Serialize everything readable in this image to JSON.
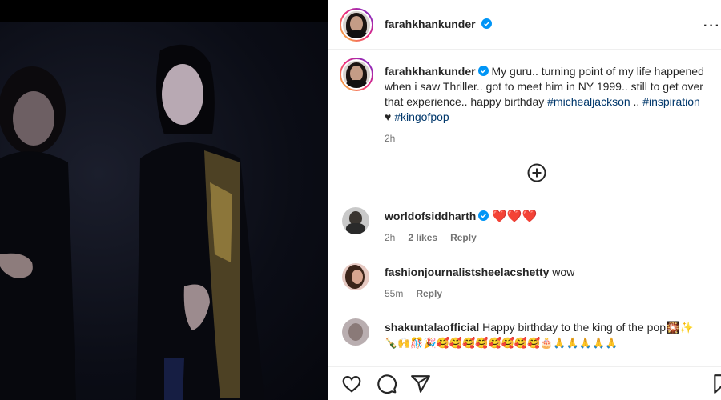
{
  "post": {
    "author": "farahkhankunder",
    "caption_text": "My guru.. turning point of my life happened when i saw Thriller.. got to meet him in NY 1999.. still to get over that experience.. happy birthday ",
    "tag1": "#michealjackson",
    "mid": " .. ",
    "tag2": "#inspiration",
    "heart": "♥ ",
    "tag3": "#kingofpop",
    "time": "2h",
    "more": "···"
  },
  "comments": [
    {
      "user": "worldofsiddharth",
      "verified": true,
      "text": "❤️❤️❤️",
      "time": "2h",
      "likes": "2 likes",
      "reply": "Reply"
    },
    {
      "user": "fashionjournalistsheelacshetty",
      "verified": false,
      "text": "wow",
      "time": "55m",
      "likes": "",
      "reply": "Reply"
    },
    {
      "user": "shakuntalaofficial",
      "verified": false,
      "text": "Happy birthday to the king of the pop🎇✨",
      "text2": "🍾🙌🎊🎉🥰🥰🥰🥰🥰🥰🥰🥰🎂🙏🙏🙏🙏🙏",
      "time": "",
      "likes": "",
      "reply": ""
    }
  ],
  "colors": {
    "verified": "#0095f6",
    "hashtag": "#00376b",
    "heart": "#ed2b39",
    "meta": "#737373"
  },
  "icons": [
    "verified-badge-icon",
    "add-comment-icon",
    "like-icon",
    "comment-icon",
    "share-icon",
    "save-icon",
    "more-options-icon"
  ]
}
